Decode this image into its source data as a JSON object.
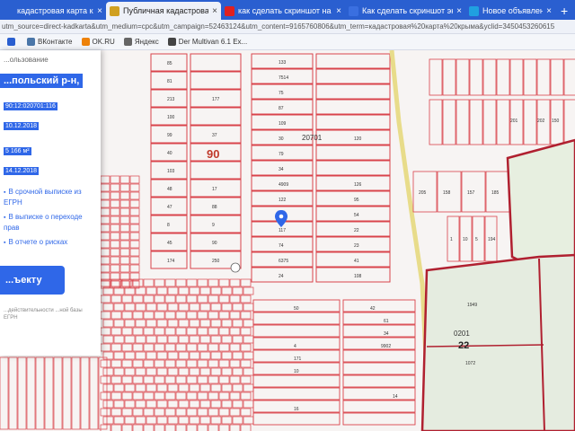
{
  "tabs": [
    {
      "label": "кадастровая карта крыма",
      "active": false,
      "favicon": "search-icon",
      "color": "#2a5fd0"
    },
    {
      "label": "Публичная кадастровая карта",
      "active": true,
      "favicon": "emblem-icon",
      "color": "#d0a020"
    },
    {
      "label": "как сделать скриншот на комп",
      "active": false,
      "favicon": "youtube-icon",
      "color": "#e02020"
    },
    {
      "label": "Как сделать скриншот экрана",
      "active": false,
      "favicon": "page-icon",
      "color": "#3a6fe0"
    },
    {
      "label": "Новое объявление",
      "active": false,
      "favicon": "avito-icon",
      "color": "#20a0e0"
    }
  ],
  "new_tab": "+",
  "close_glyph": "×",
  "address": {
    "url": "utm_source=direct-kadkarta&utm_medium=cpc&utm_campaign=52463124&utm_content=9165760806&utm_term=кадастровая%20карта%20крыма&yclid=3450453260615"
  },
  "bookmarks": [
    {
      "label": "",
      "icon": "circle-icon",
      "color": "#2a5fd0"
    },
    {
      "label": "ВКонтакте",
      "icon": "vk-icon",
      "color": "#4a76a8"
    },
    {
      "label": "OK.RU",
      "icon": "ok-icon",
      "color": "#ee8208"
    },
    {
      "label": "Яндекс",
      "icon": "yandex-icon",
      "color": "#666666"
    },
    {
      "label": "Der Multivan 6.1 Ex...",
      "icon": "vw-icon",
      "color": "#444444"
    }
  ],
  "panel": {
    "title": "...ользование",
    "district": "...польский р-н,",
    "cadastral_number": "90:12:020701:116",
    "date1": "10.12.2018",
    "area": "5 166 м²",
    "date2": "14.12.2018",
    "link1": "В срочной выписке из ЕГРН",
    "link2": "В выписке о переходе прав",
    "link3": "В отчете о рисках",
    "button": "...ъекту",
    "footer": "...действительности ...ной базы ЕГРН"
  },
  "map": {
    "quarter_label": "90",
    "block_label": "20701",
    "zone_label": "22",
    "zone_code": "0201",
    "plot_numbers_col1": [
      "85",
      "81",
      "213",
      "100",
      "99",
      "40",
      "103",
      "48",
      "47",
      "8",
      "45",
      "174"
    ],
    "plot_numbers_col2": [
      "",
      "",
      "177",
      "",
      "37",
      "",
      "",
      "17",
      "88",
      "9",
      "90",
      "250"
    ],
    "plot_numbers_col3": [
      "133",
      "7514",
      "75",
      "87",
      "109",
      "30",
      "79",
      "34",
      "4909",
      "122",
      "116",
      "117",
      "74",
      "6375",
      "24"
    ],
    "plot_numbers_col4": [
      "",
      "",
      "",
      "",
      "",
      "120",
      "",
      "",
      "126",
      "95",
      "54",
      "22",
      "23",
      "41",
      "108"
    ],
    "plot_numbers_right": [
      "205",
      "158",
      "157",
      "185",
      "1",
      "10",
      "5",
      "194",
      "201",
      "202",
      "150",
      "1"
    ],
    "plot_numbers_bottom": [
      "50",
      "42",
      "61",
      "34",
      "9902",
      "4",
      "171",
      "10",
      "14",
      "16",
      "1949",
      "1072"
    ]
  }
}
